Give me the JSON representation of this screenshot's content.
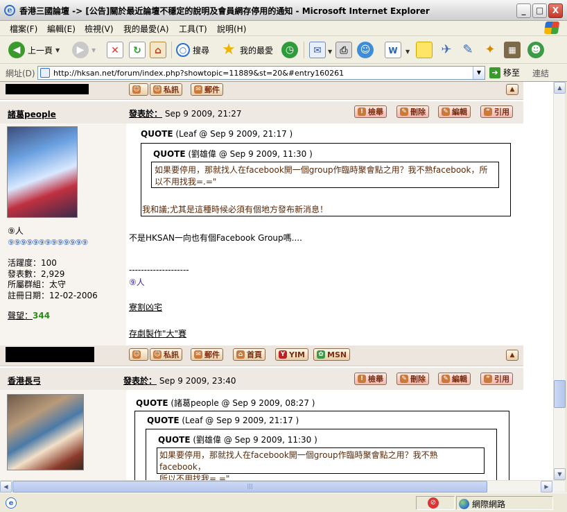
{
  "window": {
    "title": "香港三國論壇 -> [公告]關於最近論壇不穩定的說明及會員網存停用的通知 - Microsoft Internet Explorer",
    "icon": "ie-icon",
    "buttons": {
      "min": "_",
      "max": "□",
      "close": "X"
    }
  },
  "menu": [
    "檔案(F)",
    "編輯(E)",
    "檢視(V)",
    "我的最愛(A)",
    "工具(T)",
    "說明(H)"
  ],
  "toolbar": {
    "back_label": "上一頁",
    "search_label": "搜尋",
    "favorites_label": "我的最愛"
  },
  "address": {
    "label": "網址(D)",
    "url": "http://hksan.net/forum/index.php?showtopic=11889&st=20&#entry160261",
    "go_label": "移至",
    "links_label": "連結"
  },
  "status": {
    "zone": "網際網路"
  },
  "buttons": {
    "pm": "私訊",
    "email": "郵件",
    "home": "首頁",
    "yim": "YIM",
    "msn": "MSN",
    "report": "檢舉",
    "delete": "刪除",
    "edit": "編輯",
    "quote": "引用",
    "up": "▲"
  },
  "posts": [
    {
      "username": "諸葛people",
      "posted_label": "發表於：",
      "posted_date": "Sep 9 2009, 21:27",
      "group_line": "⑨人",
      "dots": "⑨⑨⑨⑨⑨⑨⑨⑨⑨⑨⑨⑨⑨",
      "stats": [
        "活躍度：100",
        "發表數：2,929",
        "所屬群組：太守",
        "註冊日期：12-02-2006"
      ],
      "rep_label": "聲望：",
      "rep_value": "344",
      "quote_outer_label": "QUOTE",
      "quote_outer_src": "(Leaf @ Sep 9 2009, 21:17 )",
      "quote_inner_label": "QUOTE",
      "quote_inner_src": "(劉雄偉 @ Sep 9 2009, 11:30 )",
      "quote_inner_text": "如果要停用，那就找人在facebook開一個group作臨時聚會點之用？我不熟facebook，所以不用找我=.=\"",
      "quote_outer_text": "我和議;尤其是這種時候必須有個地方發布新消息！",
      "body": "不是HKSAN一向也有個Facebook Group嗎....",
      "sig_sep": "--------------------",
      "sig_nick": "⑨人",
      "sig_link1": "寮割凶宅",
      "sig_link2": "存劇製作\"大\"賽"
    },
    {
      "username": "香港長弓",
      "posted_label": "發表於：",
      "posted_date": "Sep 9 2009, 23:40",
      "q1_label": "QUOTE",
      "q1_src": "(諸葛people @ Sep 9 2009, 08:27 )",
      "q2_label": "QUOTE",
      "q2_src": "(Leaf @ Sep 9 2009, 21:17 )",
      "q3_label": "QUOTE",
      "q3_src": "(劉雄偉 @ Sep 9 2009, 11:30 )",
      "q3_text": "如果要停用，那就找人在facebook開一個group作臨時聚會點之用？我不熟facebook，\n所以不用找我=.=\""
    }
  ]
}
